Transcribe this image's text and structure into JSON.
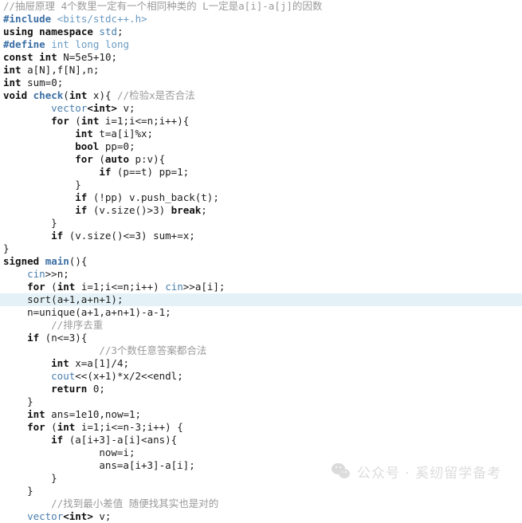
{
  "editor": {
    "language": "C++",
    "background_color": "#ffffff",
    "highlight_color": "#e4f2f7",
    "comment_color": "#9a9a9a",
    "keyword_color": "#111111",
    "preprocessor_color": "#3a6ea5",
    "function_color": "#3a6ea5",
    "type_color": "#6a9bc3",
    "highlighted_line_number": 24,
    "lines": [
      {
        "n": 1,
        "indent": 0,
        "highlight": false,
        "tokens": [
          {
            "t": "comment",
            "s": "//抽屉原理 4个数里一定有一个相同种类的 L一定是a[i]-a[j]的因数"
          }
        ]
      },
      {
        "n": 2,
        "indent": 0,
        "highlight": false,
        "tokens": [
          {
            "t": "pre",
            "s": "#include"
          },
          {
            "t": "plain",
            "s": " "
          },
          {
            "t": "type",
            "s": "<bits/stdc++.h>"
          }
        ]
      },
      {
        "n": 3,
        "indent": 0,
        "highlight": false,
        "tokens": [
          {
            "t": "kw",
            "s": "using namespace"
          },
          {
            "t": "plain",
            "s": " "
          },
          {
            "t": "id",
            "s": "std"
          },
          {
            "t": "plain",
            "s": ";"
          }
        ]
      },
      {
        "n": 4,
        "indent": 0,
        "highlight": false,
        "tokens": [
          {
            "t": "pre",
            "s": "#define"
          },
          {
            "t": "plain",
            "s": " "
          },
          {
            "t": "type",
            "s": "int long long"
          }
        ]
      },
      {
        "n": 5,
        "indent": 0,
        "highlight": false,
        "tokens": [
          {
            "t": "kw",
            "s": "const int"
          },
          {
            "t": "plain",
            "s": " N=5e5+10;"
          }
        ]
      },
      {
        "n": 6,
        "indent": 0,
        "highlight": false,
        "tokens": [
          {
            "t": "kw",
            "s": "int"
          },
          {
            "t": "plain",
            "s": " a[N],f[N],n;"
          }
        ]
      },
      {
        "n": 7,
        "indent": 0,
        "highlight": false,
        "tokens": [
          {
            "t": "kw",
            "s": "int"
          },
          {
            "t": "plain",
            "s": " sum=0;"
          }
        ]
      },
      {
        "n": 8,
        "indent": 0,
        "highlight": false,
        "tokens": [
          {
            "t": "kw",
            "s": "void"
          },
          {
            "t": "plain",
            "s": " "
          },
          {
            "t": "fn",
            "s": "check"
          },
          {
            "t": "plain",
            "s": "("
          },
          {
            "t": "kw",
            "s": "int"
          },
          {
            "t": "plain",
            "s": " x){ "
          },
          {
            "t": "comment",
            "s": "//检验x是否合法"
          }
        ]
      },
      {
        "n": 9,
        "indent": 8,
        "highlight": false,
        "tokens": [
          {
            "t": "id",
            "s": "vector"
          },
          {
            "t": "kw",
            "s": "<int>"
          },
          {
            "t": "plain",
            "s": " v;"
          }
        ]
      },
      {
        "n": 10,
        "indent": 8,
        "highlight": false,
        "tokens": [
          {
            "t": "kw",
            "s": "for"
          },
          {
            "t": "plain",
            "s": " ("
          },
          {
            "t": "kw",
            "s": "int"
          },
          {
            "t": "plain",
            "s": " i=1;i<=n;i++){"
          }
        ]
      },
      {
        "n": 11,
        "indent": 12,
        "highlight": false,
        "tokens": [
          {
            "t": "kw",
            "s": "int"
          },
          {
            "t": "plain",
            "s": " t=a[i]%x;"
          }
        ]
      },
      {
        "n": 12,
        "indent": 12,
        "highlight": false,
        "tokens": [
          {
            "t": "kw",
            "s": "bool"
          },
          {
            "t": "plain",
            "s": " pp=0;"
          }
        ]
      },
      {
        "n": 13,
        "indent": 12,
        "highlight": false,
        "tokens": [
          {
            "t": "kw",
            "s": "for"
          },
          {
            "t": "plain",
            "s": " ("
          },
          {
            "t": "kw",
            "s": "auto"
          },
          {
            "t": "plain",
            "s": " p:v){"
          }
        ]
      },
      {
        "n": 14,
        "indent": 16,
        "highlight": false,
        "tokens": [
          {
            "t": "kw",
            "s": "if"
          },
          {
            "t": "plain",
            "s": " (p==t) pp=1;"
          }
        ]
      },
      {
        "n": 15,
        "indent": 12,
        "highlight": false,
        "tokens": [
          {
            "t": "plain",
            "s": "}"
          }
        ]
      },
      {
        "n": 16,
        "indent": 12,
        "highlight": false,
        "tokens": [
          {
            "t": "kw",
            "s": "if"
          },
          {
            "t": "plain",
            "s": " (!pp) v.push_back(t);"
          }
        ]
      },
      {
        "n": 17,
        "indent": 12,
        "highlight": false,
        "tokens": [
          {
            "t": "kw",
            "s": "if"
          },
          {
            "t": "plain",
            "s": " (v.size()>3) "
          },
          {
            "t": "kw",
            "s": "break"
          },
          {
            "t": "plain",
            "s": ";"
          }
        ]
      },
      {
        "n": 18,
        "indent": 8,
        "highlight": false,
        "tokens": [
          {
            "t": "plain",
            "s": "}"
          }
        ]
      },
      {
        "n": 19,
        "indent": 8,
        "highlight": false,
        "tokens": [
          {
            "t": "kw",
            "s": "if"
          },
          {
            "t": "plain",
            "s": " (v.size()<=3) sum+=x;"
          }
        ]
      },
      {
        "n": 20,
        "indent": 0,
        "highlight": false,
        "tokens": [
          {
            "t": "plain",
            "s": "}"
          }
        ]
      },
      {
        "n": 21,
        "indent": 0,
        "highlight": false,
        "tokens": [
          {
            "t": "kw",
            "s": "signed"
          },
          {
            "t": "plain",
            "s": " "
          },
          {
            "t": "fn",
            "s": "main"
          },
          {
            "t": "plain",
            "s": "(){"
          }
        ]
      },
      {
        "n": 22,
        "indent": 4,
        "highlight": false,
        "tokens": [
          {
            "t": "id",
            "s": "cin"
          },
          {
            "t": "plain",
            "s": ">>n;"
          }
        ]
      },
      {
        "n": 23,
        "indent": 4,
        "highlight": false,
        "tokens": [
          {
            "t": "kw",
            "s": "for"
          },
          {
            "t": "plain",
            "s": " ("
          },
          {
            "t": "kw",
            "s": "int"
          },
          {
            "t": "plain",
            "s": " i=1;i<=n;i++) "
          },
          {
            "t": "id",
            "s": "cin"
          },
          {
            "t": "plain",
            "s": ">>a[i];"
          }
        ]
      },
      {
        "n": 24,
        "indent": 4,
        "highlight": true,
        "tokens": [
          {
            "t": "plain",
            "s": "sort(a+1,a+n+1);"
          }
        ]
      },
      {
        "n": 25,
        "indent": 4,
        "highlight": false,
        "tokens": [
          {
            "t": "plain",
            "s": "n=unique(a+1,a+n+1)-a-1;"
          }
        ]
      },
      {
        "n": 26,
        "indent": 8,
        "highlight": false,
        "tokens": [
          {
            "t": "comment",
            "s": "//排序去重"
          }
        ]
      },
      {
        "n": 27,
        "indent": 4,
        "highlight": false,
        "tokens": [
          {
            "t": "kw",
            "s": "if"
          },
          {
            "t": "plain",
            "s": " (n<=3){"
          }
        ]
      },
      {
        "n": 28,
        "indent": 16,
        "highlight": false,
        "tokens": [
          {
            "t": "comment",
            "s": "//3个数任意答案都合法"
          }
        ]
      },
      {
        "n": 29,
        "indent": 8,
        "highlight": false,
        "tokens": [
          {
            "t": "kw",
            "s": "int"
          },
          {
            "t": "plain",
            "s": " x=a[1]/4;"
          }
        ]
      },
      {
        "n": 30,
        "indent": 8,
        "highlight": false,
        "tokens": [
          {
            "t": "id",
            "s": "cout"
          },
          {
            "t": "plain",
            "s": "<<(x+1)*x/2<<endl;"
          }
        ]
      },
      {
        "n": 31,
        "indent": 8,
        "highlight": false,
        "tokens": [
          {
            "t": "kw",
            "s": "return"
          },
          {
            "t": "plain",
            "s": " 0;"
          }
        ]
      },
      {
        "n": 32,
        "indent": 4,
        "highlight": false,
        "tokens": [
          {
            "t": "plain",
            "s": "}"
          }
        ]
      },
      {
        "n": 33,
        "indent": 4,
        "highlight": false,
        "tokens": [
          {
            "t": "kw",
            "s": "int"
          },
          {
            "t": "plain",
            "s": " ans=1e10,now=1;"
          }
        ]
      },
      {
        "n": 34,
        "indent": 4,
        "highlight": false,
        "tokens": [
          {
            "t": "kw",
            "s": "for"
          },
          {
            "t": "plain",
            "s": " ("
          },
          {
            "t": "kw",
            "s": "int"
          },
          {
            "t": "plain",
            "s": " i=1;i<=n-3;i++) {"
          }
        ]
      },
      {
        "n": 35,
        "indent": 8,
        "highlight": false,
        "tokens": [
          {
            "t": "kw",
            "s": "if"
          },
          {
            "t": "plain",
            "s": " (a[i+3]-a[i]<ans){"
          }
        ]
      },
      {
        "n": 36,
        "indent": 16,
        "highlight": false,
        "tokens": [
          {
            "t": "plain",
            "s": "now=i;"
          }
        ]
      },
      {
        "n": 37,
        "indent": 16,
        "highlight": false,
        "tokens": [
          {
            "t": "plain",
            "s": "ans=a[i+3]-a[i];"
          }
        ]
      },
      {
        "n": 38,
        "indent": 8,
        "highlight": false,
        "tokens": [
          {
            "t": "plain",
            "s": "}"
          }
        ]
      },
      {
        "n": 39,
        "indent": 4,
        "highlight": false,
        "tokens": [
          {
            "t": "plain",
            "s": "}"
          }
        ]
      },
      {
        "n": 40,
        "indent": 8,
        "highlight": false,
        "tokens": [
          {
            "t": "comment",
            "s": "//找到最小差值 随便找其实也是对的"
          }
        ]
      },
      {
        "n": 41,
        "indent": 4,
        "highlight": false,
        "tokens": [
          {
            "t": "id",
            "s": "vector"
          },
          {
            "t": "kw",
            "s": "<int>"
          },
          {
            "t": "plain",
            "s": " v;"
          }
        ]
      }
    ]
  },
  "watermark": {
    "icon": "wechat-icon",
    "text": "公众号 · 奚纫留学备考",
    "color": "#d6d6d6"
  }
}
